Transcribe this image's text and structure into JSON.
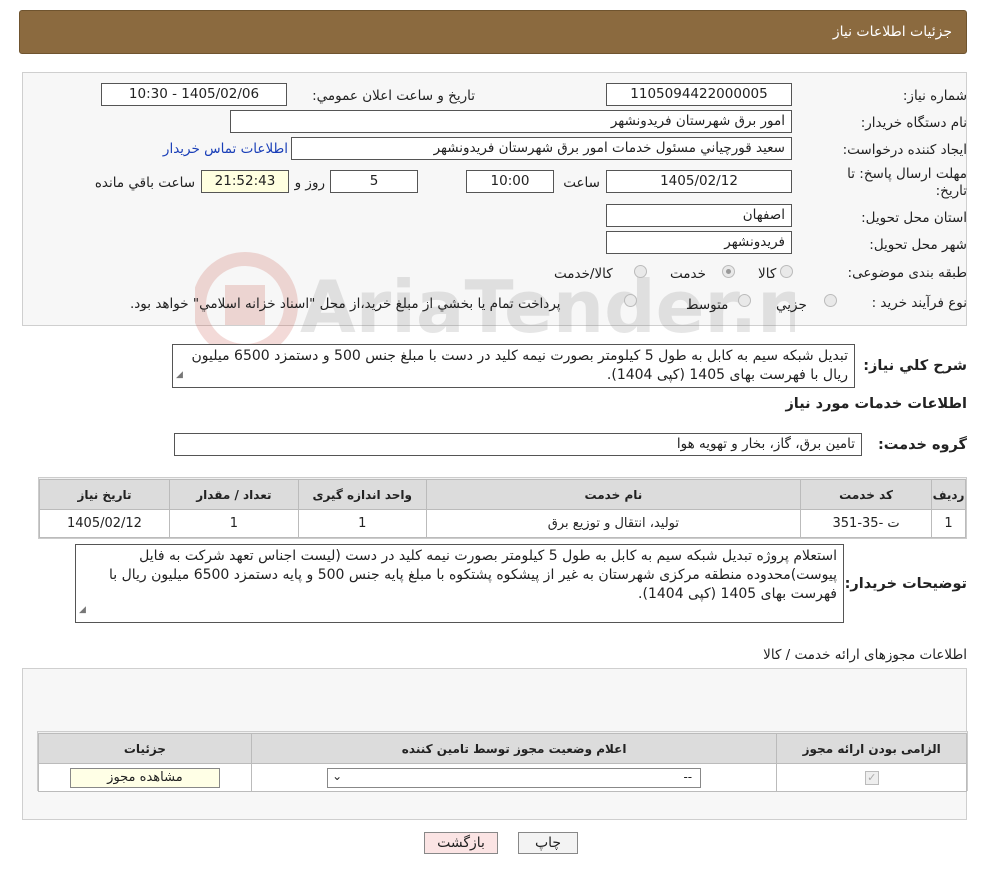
{
  "header": {
    "title": "جزئيات اطلاعات نياز"
  },
  "form": {
    "need_number_label": "شماره نياز:",
    "need_number": "1105094422000005",
    "announce_label": "تاريخ و ساعت اعلان عمومي:",
    "announce_value": "1405/02/06 - 10:30",
    "buyer_label": "نام دستگاه خريدار:",
    "buyer_value": "امور برق شهرستان فريدونشهر",
    "creator_label": "ايجاد کننده درخواست:",
    "creator_value": "سعيد قورچياني مسئول خدمات امور برق شهرستان فريدونشهر",
    "contact_link": "اطلاعات تماس خريدار",
    "deadline_label": "مهلت ارسال پاسخ: تا تاريخ:",
    "deadline_date": "1405/02/12",
    "time_label": "ساعت",
    "deadline_time": "10:00",
    "days_value": "5",
    "days_label": "روز و",
    "remaining_time": "21:52:43",
    "remaining_label": "ساعت باقي مانده",
    "province_label": "استان محل تحويل:",
    "province_value": "اصفهان",
    "city_label": "شهر محل تحويل:",
    "city_value": "فريدونشهر",
    "category_label": "طبقه بندی موضوعی:",
    "category_options": [
      "کالا",
      "خدمت",
      "کالا/خدمت"
    ],
    "category_selected": "خدمت",
    "process_label": "نوع فرآيند خريد :",
    "process_options": [
      "جزيي",
      "متوسط"
    ],
    "process_note": "پرداخت تمام يا بخشي از مبلغ خريد،از محل \"اسناد خزانه اسلامي\" خواهد بود."
  },
  "summary": {
    "label": "شرح کلي نياز:",
    "text": "تبديل شبکه سيم به کابل به طول 5 کيلومتر بصورت نيمه کليد در دست با مبلغ جنس 500 و دستمزد 6500 ميليون ريال با فهرست بهای 1405 (کپی 1404)."
  },
  "services": {
    "section_title": "اطلاعات خدمات مورد نياز",
    "group_label": "گروه خدمت:",
    "group_value": "تامين برق، گاز، بخار و تهويه هوا",
    "columns": [
      "رديف",
      "کد خدمت",
      "نام خدمت",
      "واحد اندازه گيری",
      "تعداد / مقدار",
      "تاريخ نياز"
    ],
    "rows": [
      {
        "index": "1",
        "code": "ت -35-351",
        "name": "توليد، انتقال و توزيع برق",
        "unit": "1",
        "qty": "1",
        "date": "1405/02/12"
      }
    ]
  },
  "buyer_notes": {
    "label": "توضيحات خريدار:",
    "text": "استعلام پروژه تبديل شبکه سيم به کابل به طول 5 کيلومتر بصورت نيمه کليد در دست (ليست اجناس تعهد شرکت به فايل پيوست)محدوده منطقه مرکزی شهرستان به غير از پيشکوه پشتکوه با مبلغ پايه جنس 500 و پايه دستمزد 6500 ميليون ريال با فهرست بهای 1405 (کپی 1404)."
  },
  "permits": {
    "section_title": "اطلاعات مجوزهای ارائه خدمت / کالا",
    "columns": [
      "الزامی بودن ارائه مجوز",
      "اعلام وضعيت مجوز توسط تامين کننده",
      "جزئيات"
    ],
    "select_value": "--",
    "view_button": "مشاهده مجوز"
  },
  "actions": {
    "print": "چاپ",
    "back": "بازگشت"
  },
  "watermark": {
    "text": "AriaTender.neT",
    "color": "#c0392b"
  }
}
